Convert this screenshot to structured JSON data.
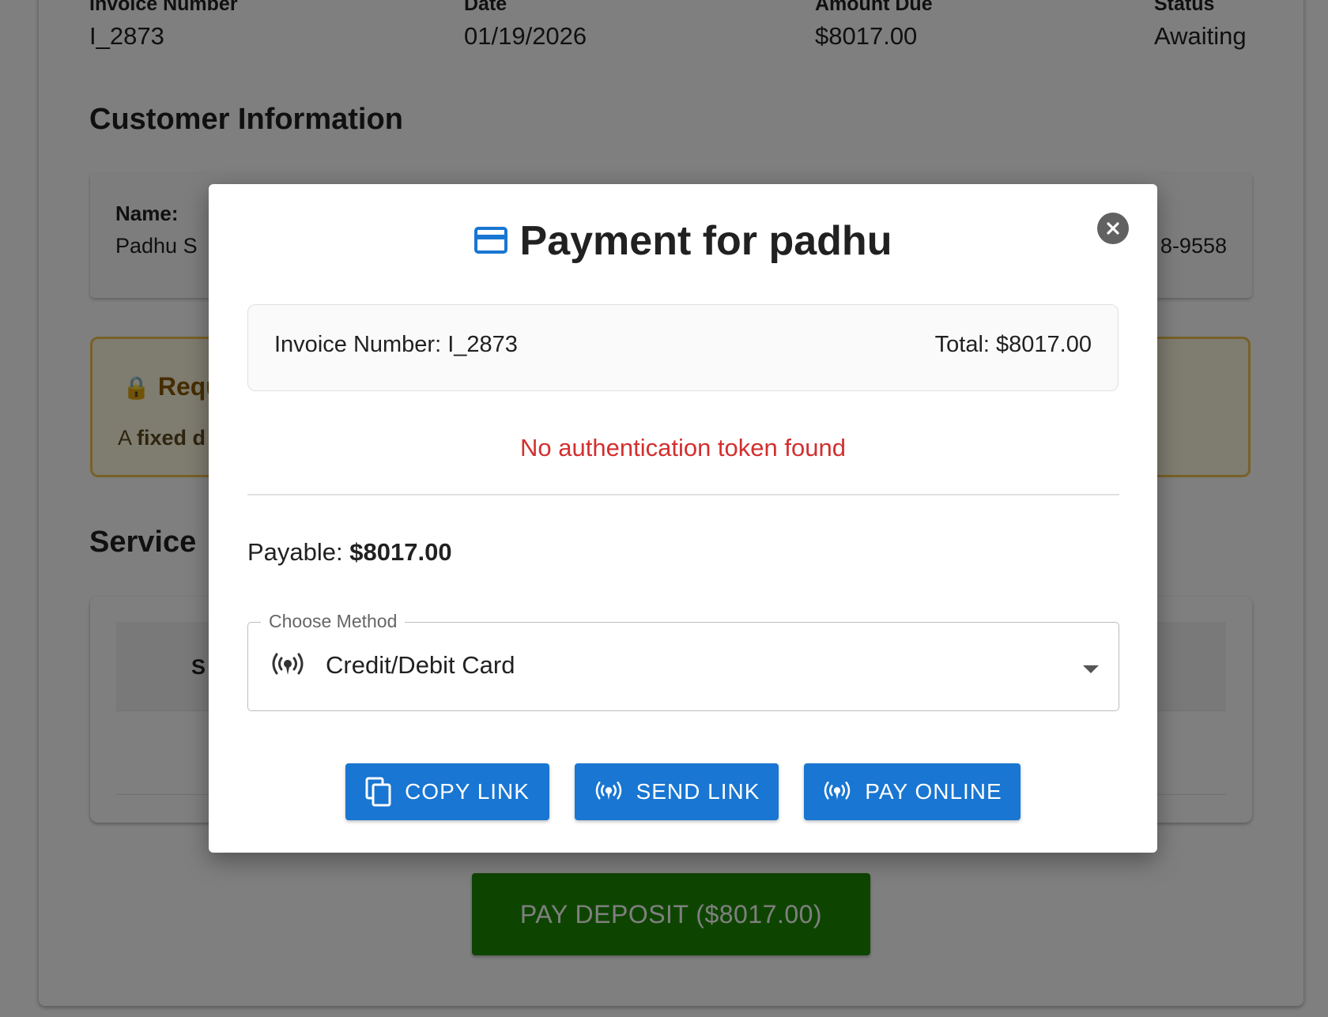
{
  "invoice_header": {
    "columns": [
      {
        "label": "Invoice Number",
        "value": "I_2873"
      },
      {
        "label": "Date",
        "value": "01/19/2026"
      },
      {
        "label": "Amount Due",
        "value": "$8017.00"
      },
      {
        "label": "Status",
        "value": "Awaiting"
      }
    ]
  },
  "customer": {
    "heading": "Customer Information",
    "name_label": "Name:",
    "name_value": "Padhu S",
    "phone_partial": "8-9558"
  },
  "deposit_notice": {
    "title_partial": "Requ",
    "text_prefix": "A ",
    "text_bold_partial": "fixed d"
  },
  "services": {
    "heading_partial": "Service",
    "column_partial": "S"
  },
  "pay_deposit_button": "PAY DEPOSIT ($8017.00)",
  "modal": {
    "title": "Payment for padhu",
    "invoice_number_text": "Invoice Number: I_2873",
    "total_text": "Total: $8017.00",
    "error": "No authentication token found",
    "payable_label": "Payable:",
    "payable_amount": "$8017.00",
    "method_label": "Choose Method",
    "method_value": "Credit/Debit Card",
    "buttons": {
      "copy_link": "COPY LINK",
      "send_link": "SEND LINK",
      "pay_online": "PAY ONLINE"
    }
  },
  "colors": {
    "primary": "#1976d2",
    "error": "#d32f2f",
    "deposit_button": "#1b8a00",
    "notice_border": "#f0c350"
  }
}
